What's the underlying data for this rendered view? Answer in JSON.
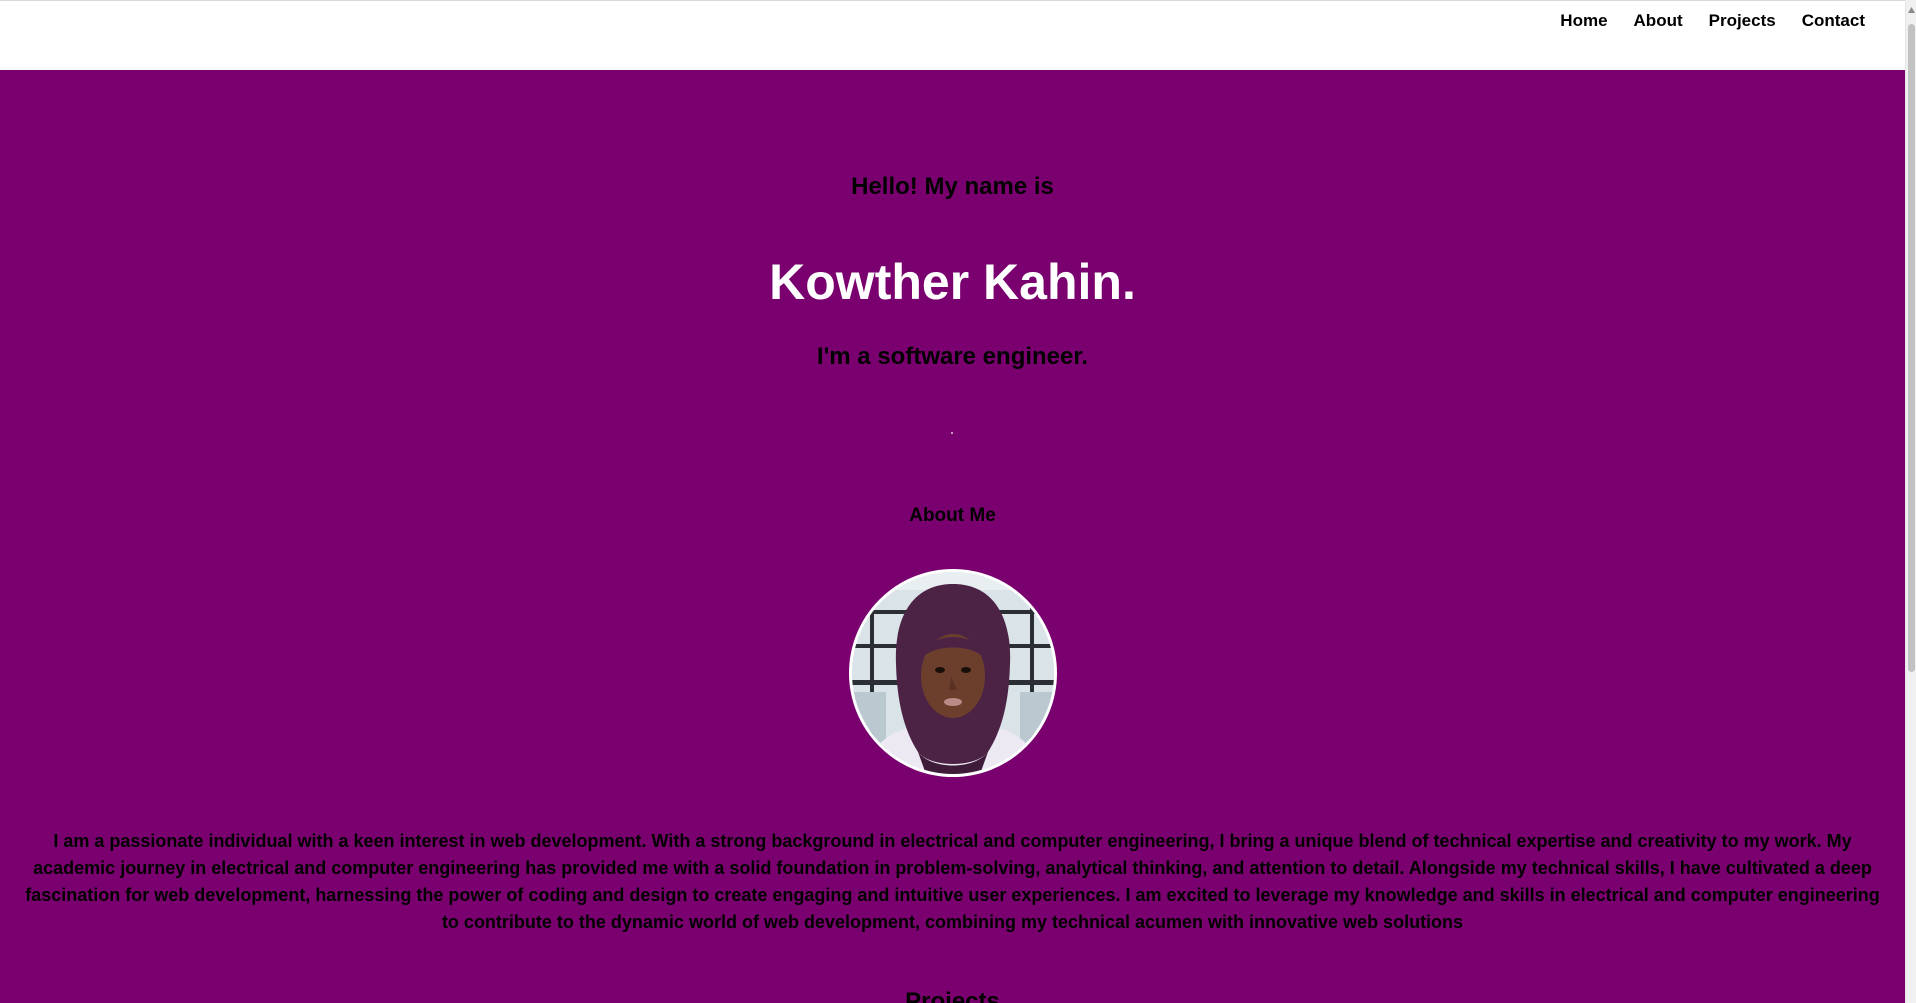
{
  "nav": {
    "links": [
      {
        "label": "Home"
      },
      {
        "label": "About"
      },
      {
        "label": "Projects"
      },
      {
        "label": "Contact"
      }
    ]
  },
  "hero": {
    "greeting": "Hello! My name is",
    "name": "Kowther Kahin.",
    "role": "I'm a software engineer."
  },
  "about": {
    "title": "About Me",
    "description": "I am a passionate individual with a keen interest in web development. With a strong background in electrical and computer engineering, I bring a unique blend of technical expertise and creativity to my work. My academic journey in electrical and computer engineering has provided me with a solid foundation in problem-solving, analytical thinking, and attention to detail. Alongside my technical skills, I have cultivated a deep fascination for web development, harnessing the power of coding and design to create engaging and intuitive user experiences. I am excited to leverage my knowledge and skills in electrical and computer engineering to contribute to the dynamic world of web development, combining my technical acumen with innovative web solutions"
  },
  "projects": {
    "title": "Projects"
  },
  "colors": {
    "background": "#7a006f",
    "nav_background": "#ffffff",
    "heading_text": "#000000",
    "name_text": "#ffffff"
  }
}
